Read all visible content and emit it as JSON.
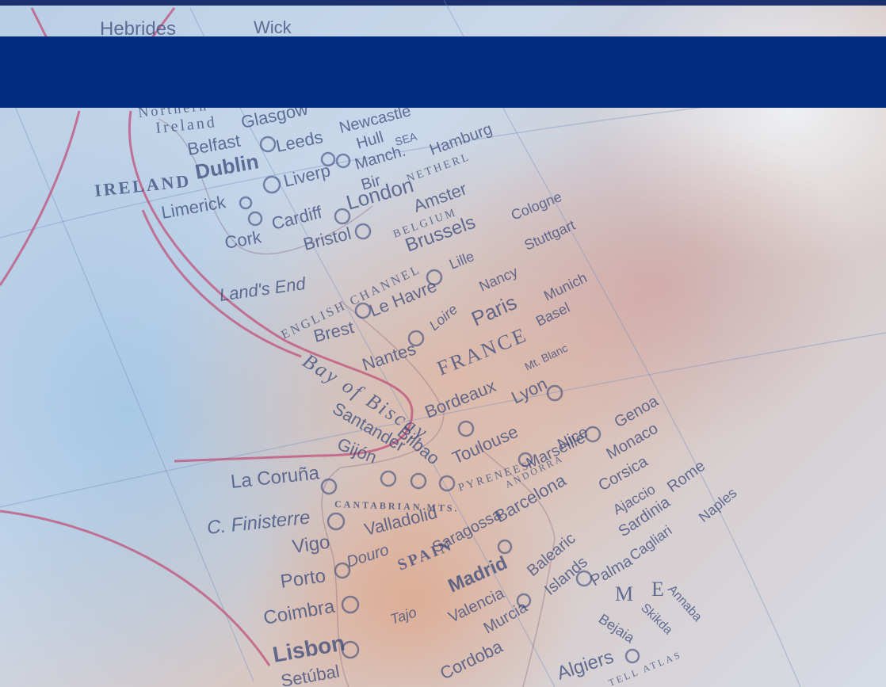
{
  "map": {
    "labels": {
      "hebrides": "Hebrides",
      "wick": "Wick",
      "northern": "Northern",
      "ireland_small": "Ireland",
      "glasgow": "Glasgow",
      "newcastle": "Newcastle",
      "belfast": "Belfast",
      "leeds": "Leeds",
      "hull": "Hull",
      "sea": "SEA",
      "hamburg": "Hamburg",
      "dublin": "Dublin",
      "liverpool": "Liverp",
      "manch": "Manch.",
      "birm": "Bir",
      "netherlands": "NETHERL",
      "ireland": "IRELAND",
      "limerick": "Limerick",
      "cardiff": "Cardiff",
      "london": "London",
      "amster": "Amster",
      "belgium": "BELGIUM",
      "cologne": "Cologne",
      "cork": "Cork",
      "bristol": "Bristol",
      "brussels": "Brussels",
      "stuttgart": "Stuttgart",
      "lands_end": "Land's End",
      "english_channel": "ENGLISH CHANNEL",
      "lille": "Lille",
      "nancy": "Nancy",
      "munich": "Munich",
      "le_havre": "Le Havre",
      "loire": "Loire",
      "paris": "Paris",
      "basel": "Basel",
      "brest": "Brest",
      "nantes": "Nantes",
      "france": "FRANCE",
      "mt_blanc": "Mt. Blanc",
      "bay_of_biscay": "Bay of Biscay",
      "bordeaux": "Bordeaux",
      "lyon": "Lyon",
      "genoa": "Genoa",
      "santander": "Santander",
      "bilbao": "Bilbao",
      "toulouse": "Toulouse",
      "nice": "Nice",
      "monaco": "Monaco",
      "gijon": "Gijón",
      "marseille": "Marseille",
      "andorra": "ANDORRA",
      "la_coruna": "La Coruña",
      "pyrenees": "PYRENEES",
      "corsica": "Corsica",
      "rome": "Rome",
      "cantabrian": "CANTABRIAN MTS.",
      "barcelona": "Barcelona",
      "ajaccio": "Ajaccio",
      "c_finisterre": "C. Finisterre",
      "valladolid": "Valladolid",
      "sardinia": "Sardinia",
      "naples": "Naples",
      "vigo": "Vigo",
      "douro": "Douro",
      "zaragoza": "Saragossa",
      "balearic": "Balearic",
      "islands": "Islands",
      "cagliari": "Cagliari",
      "porto": "Porto",
      "spain": "SPAIN",
      "palma": "Palma",
      "madrid": "Madrid",
      "coimbra": "Coimbra",
      "tagus": "Tajo",
      "valencia": "Valencia",
      "murcia": "Murcia",
      "bejaia": "Bejaia",
      "skikda": "Skikda",
      "annaba": "Annaba",
      "lisbon": "Lisbon",
      "cordoba": "Cordoba",
      "algiers": "Algiers",
      "atlas": "TELL ATLAS",
      "setubal": "Setúbal",
      "med_sea_m": "M",
      "med_sea_e": "E"
    },
    "colors": {
      "banner": "#022c7e",
      "top_strip": "#1c2f6e",
      "route": "#c0507a",
      "label": "#3a4a7a"
    }
  }
}
